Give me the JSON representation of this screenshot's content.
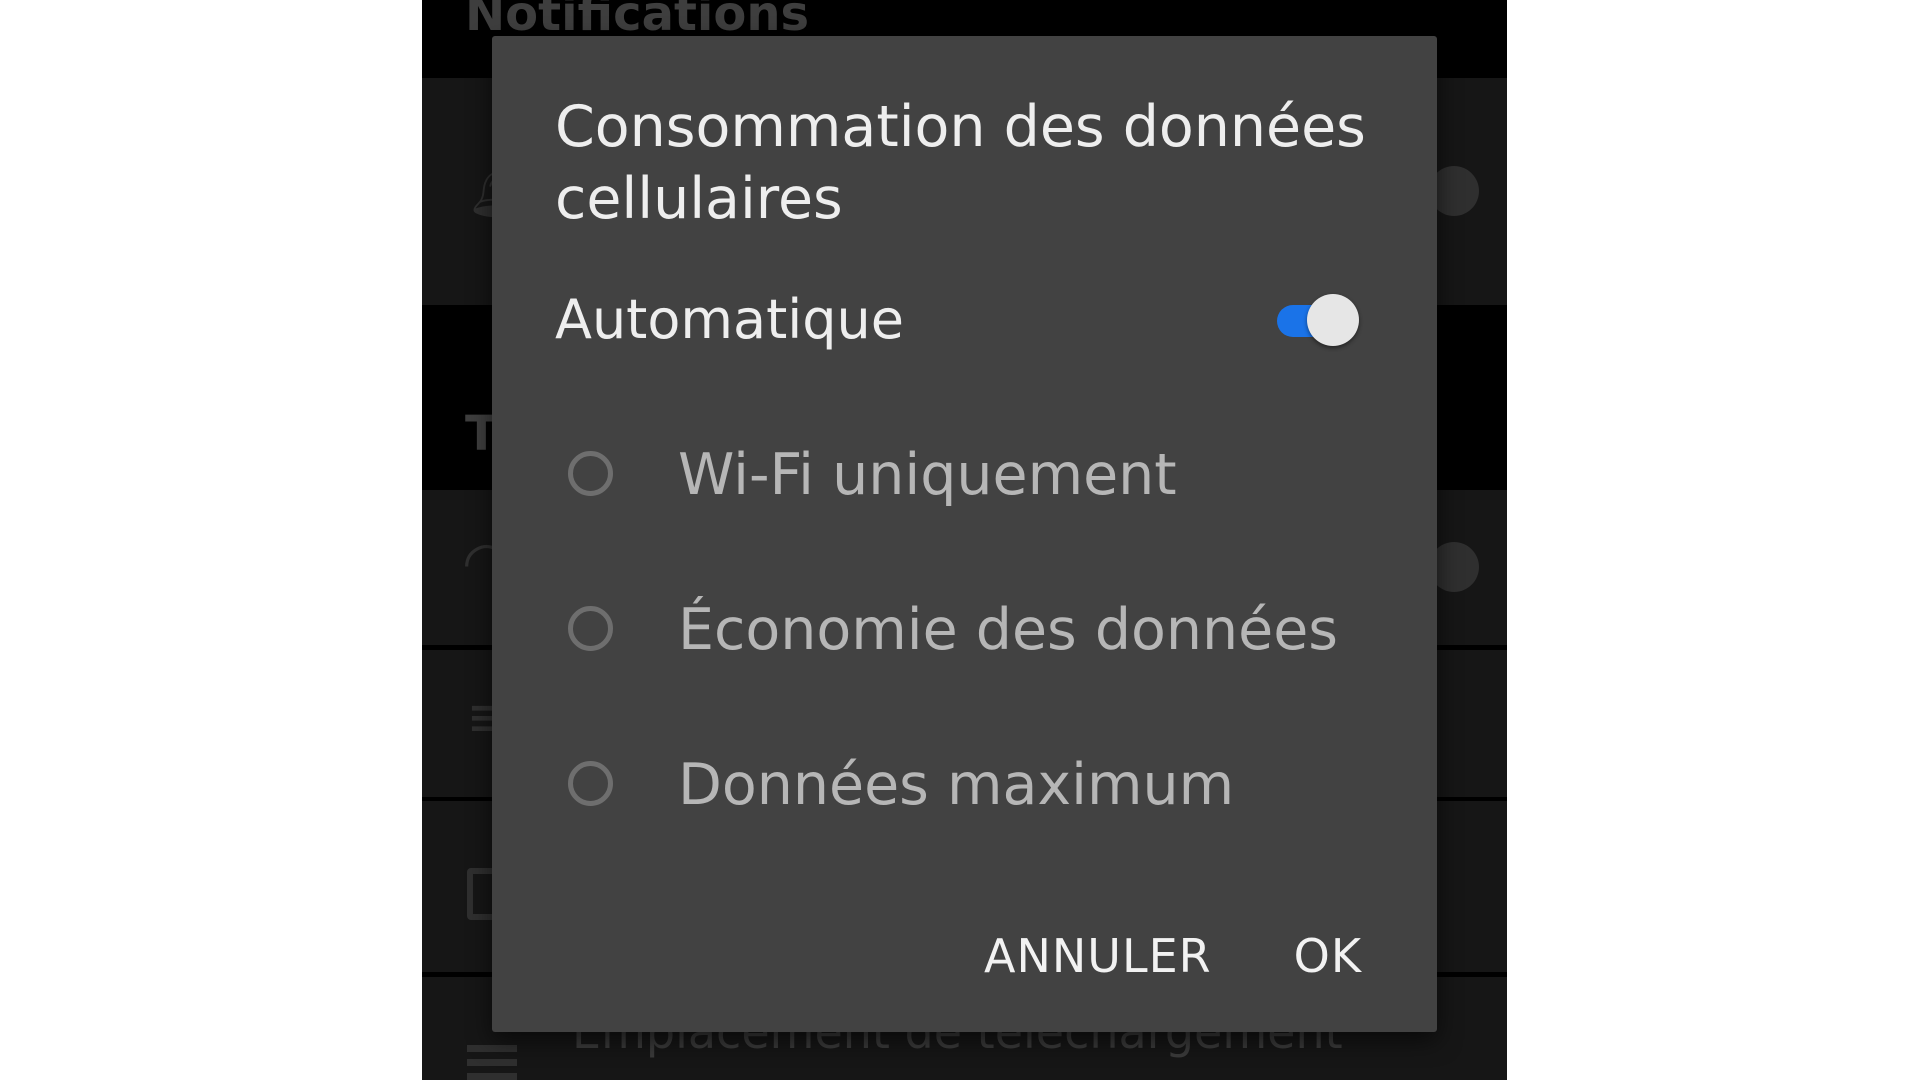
{
  "background": {
    "section_notifications": "Notifications",
    "section_t": "T",
    "row_text_partial": "Emplacement de téléchargement",
    "icons": [
      "bell-icon",
      "wifi-icon",
      "signal-icon",
      "box-icon",
      "list-icon"
    ]
  },
  "dialog": {
    "title": "Consommation des données cellulaires",
    "automatic": {
      "label": "Automatique",
      "enabled": true
    },
    "options": [
      {
        "label": "Wi-Fi uniquement",
        "selected": false
      },
      {
        "label": "Économie des données",
        "selected": false
      },
      {
        "label": "Données maximum",
        "selected": false
      }
    ],
    "buttons": {
      "cancel": "ANNULER",
      "ok": "OK"
    }
  },
  "colors": {
    "dialog_bg": "#424242",
    "toggle_on": "#1a73e8",
    "screen_bg": "#000000"
  }
}
